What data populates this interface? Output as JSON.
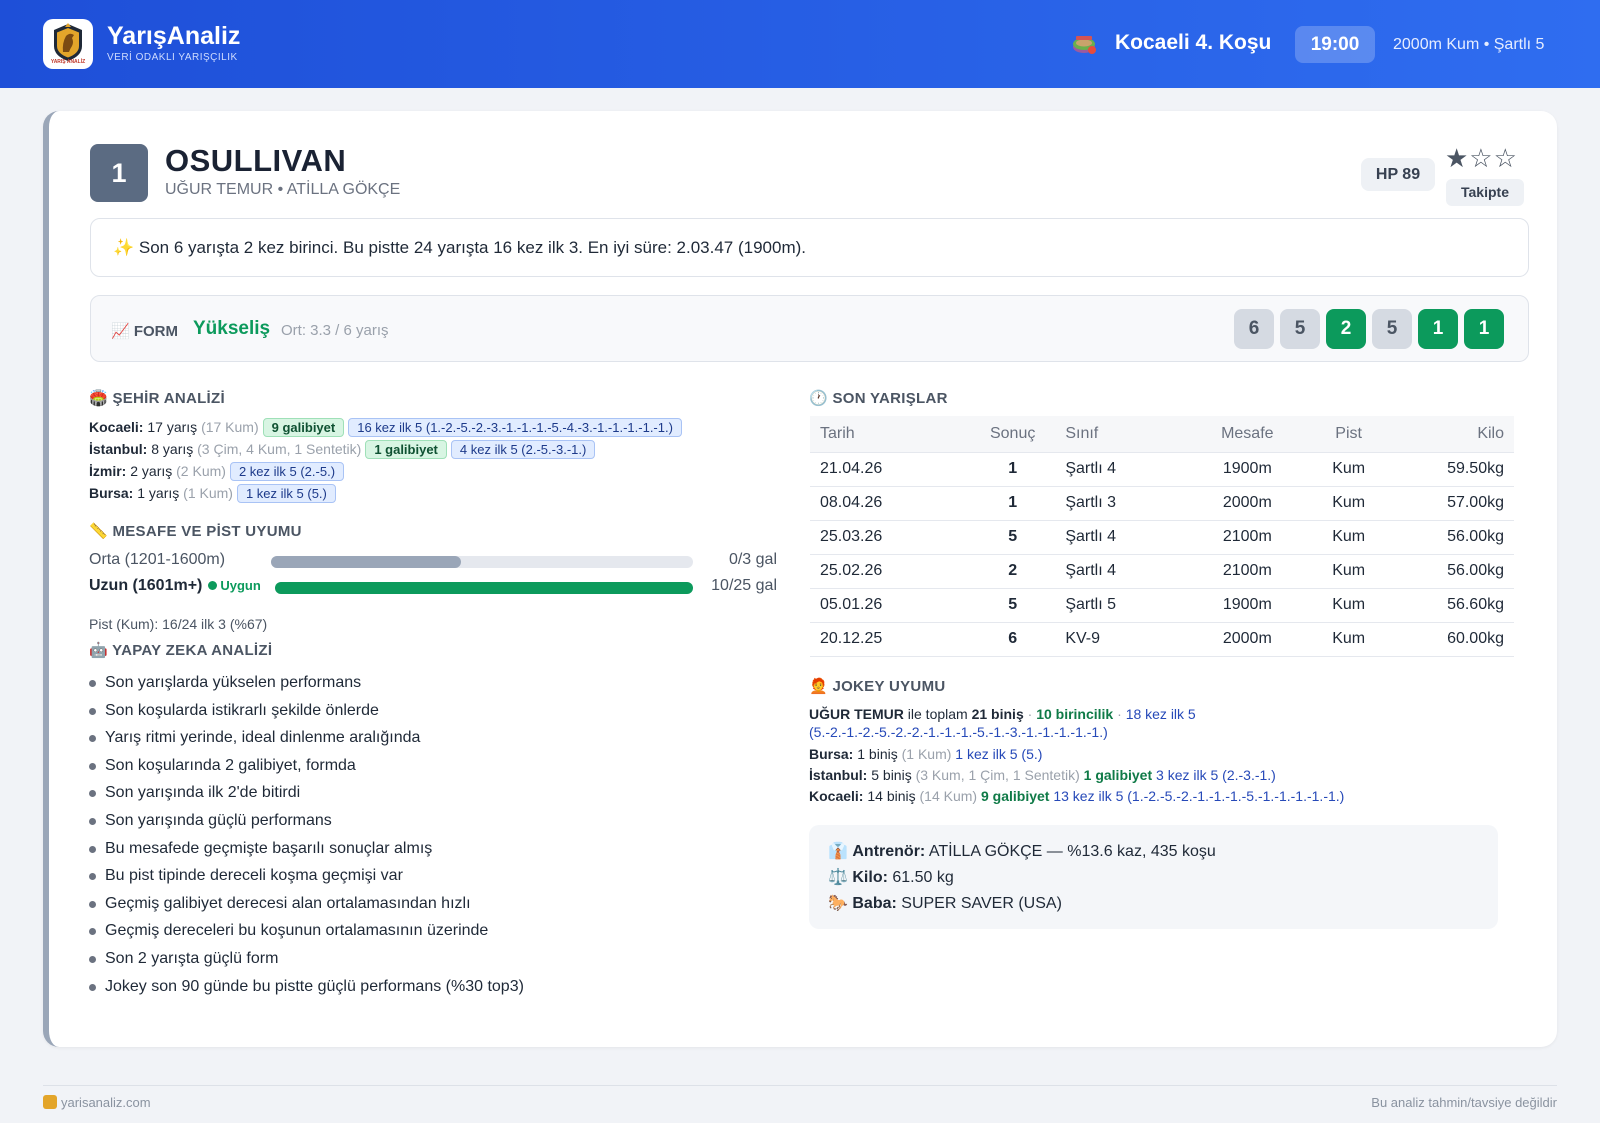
{
  "header": {
    "brand_name": "YarışAnaliz",
    "brand_tagline": "VERİ ODAKLI YARIŞÇILIK",
    "logo_text": "YARIŞ ANALİZ",
    "race_title": "Kocaeli 4. Koşu",
    "race_time": "19:00",
    "race_meta": "2000m Kum • Şartlı 5",
    "brand_color": "#2a62e8"
  },
  "horse": {
    "number": "1",
    "name": "OSULLIVAN",
    "subtitle": "UĞUR TEMUR • ATİLLA GÖKÇE",
    "hp": "HP 89",
    "stars": "★☆☆",
    "rating": 1,
    "rating_max": 3,
    "follow_label": "Takipte"
  },
  "summary": "✨ Son 6 yarışta 2 kez birinci. Bu pistte 24 yarışta 16 kez ilk 3. En iyi süre: 2.03.47 (1900m).",
  "form": {
    "label": "📈 FORM",
    "trend": "Yükseliş",
    "average": "Ort: 3.3 / 6 yarış",
    "results": [
      "6",
      "5",
      "2",
      "5",
      "1",
      "1"
    ]
  },
  "city": {
    "title": "🏟️ ŞEHİR ANALİZİ",
    "rows": [
      {
        "city": "Kocaeli:",
        "count": "17 yarış",
        "detail": "(17 Kum)",
        "win": "9 galibiyet",
        "top5": "16 kez ilk 5 (1.-2.-5.-2.-3.-1.-1.-1.-5.-4.-3.-1.-1.-1.-1.-1.)"
      },
      {
        "city": "İstanbul:",
        "count": "8 yarış",
        "detail": "(3 Çim, 4 Kum, 1 Sentetik)",
        "win": "1 galibiyet",
        "top5": "4 kez ilk 5 (2.-5.-3.-1.)"
      },
      {
        "city": "İzmir:",
        "count": "2 yarış",
        "detail": "(2 Kum)",
        "win": "",
        "top5": "2 kez ilk 5 (2.-5.)"
      },
      {
        "city": "Bursa:",
        "count": "1 yarış",
        "detail": "(1 Kum)",
        "win": "",
        "top5": "1 kez ilk 5 (5.)"
      }
    ]
  },
  "distance": {
    "title": "📏 MESAFE VE PİST UYUMU",
    "rows": [
      {
        "label": "Orta (1201-1600m)",
        "value": "0/3 gal",
        "fill": 0.45,
        "bold": false,
        "badge": ""
      },
      {
        "label": "Uzun (1601m+)",
        "value": "10/25 gal",
        "fill": 1.0,
        "bold": true,
        "badge": "Uygun"
      }
    ],
    "pist": "Pist (Kum): 16/24 ilk 3 (%67)"
  },
  "ai": {
    "title": "🤖 YAPAY ZEKA ANALİZİ",
    "items": [
      "Son yarışlarda yükselen performans",
      "Son koşularda istikrarlı şekilde önlerde",
      "Yarış ritmi yerinde, ideal dinlenme aralığında",
      "Son koşularında 2 galibiyet, formda",
      "Son yarışında ilk 2'de bitirdi",
      "Son yarışında güçlü performans",
      "Bu mesafede geçmişte başarılı sonuçlar almış",
      "Bu pist tipinde dereceli koşma geçmişi var",
      "Geçmiş galibiyet derecesi alan ortalamasından hızlı",
      "Geçmiş dereceleri bu koşunun ortalamasının üzerinde",
      "Son 2 yarışta güçlü form",
      "Jokey son 90 günde bu pistte güçlü performans (%30 top3)"
    ]
  },
  "races": {
    "title": "🕐 SON YARIŞLAR",
    "columns": [
      "Tarih",
      "Sonuç",
      "Sınıf",
      "Mesafe",
      "Pist",
      "Kilo"
    ],
    "rows": [
      {
        "date": "21.04.26",
        "result": "1",
        "class": "Şartlı 4",
        "distance": "1900m",
        "track": "Kum",
        "weight": "59.50kg"
      },
      {
        "date": "08.04.26",
        "result": "1",
        "class": "Şartlı 3",
        "distance": "2000m",
        "track": "Kum",
        "weight": "57.00kg"
      },
      {
        "date": "25.03.26",
        "result": "5",
        "class": "Şartlı 4",
        "distance": "2100m",
        "track": "Kum",
        "weight": "56.00kg"
      },
      {
        "date": "25.02.26",
        "result": "2",
        "class": "Şartlı 4",
        "distance": "2100m",
        "track": "Kum",
        "weight": "56.00kg"
      },
      {
        "date": "05.01.26",
        "result": "5",
        "class": "Şartlı 5",
        "distance": "1900m",
        "track": "Kum",
        "weight": "56.60kg"
      },
      {
        "date": "20.12.25",
        "result": "6",
        "class": "KV-9",
        "distance": "2000m",
        "track": "Kum",
        "weight": "60.00kg"
      }
    ]
  },
  "jockey": {
    "title": "🧑‍🦰 JOKEY UYUMU",
    "name": "UĞUR TEMUR",
    "intro": " ile toplam ",
    "rides": "21 biniş",
    "sep1": " · ",
    "wins": "10 birincilik",
    "sep2": " · ",
    "top5": "18 kez ilk 5",
    "top5_detail": "(5.-2.-1.-2.-5.-2.-2.-1.-1.-1.-5.-1.-3.-1.-1.-1.-1.-1.)",
    "cities": [
      {
        "city": "Bursa:",
        "rides": "1 biniş",
        "detail": "(1 Kum)",
        "win": "",
        "top5": "1 kez ilk 5 (5.)"
      },
      {
        "city": "İstanbul:",
        "rides": "5 biniş",
        "detail": "(3 Kum, 1 Çim, 1 Sentetik)",
        "win": "1 galibiyet",
        "top5": "3 kez ilk 5 (2.-3.-1.)"
      },
      {
        "city": "Kocaeli:",
        "rides": "14 biniş",
        "detail": "(14 Kum)",
        "win": "9 galibiyet",
        "top5": "13 kez ilk 5 (1.-2.-5.-2.-1.-1.-1.-5.-1.-1.-1.-1.-1.)"
      }
    ]
  },
  "info": {
    "trainer_icon": "👔",
    "trainer_label": "Antrenör:",
    "trainer_value": "ATİLLA GÖKÇE — %13.6 kaz, 435 koşu",
    "weight_icon": "⚖️",
    "weight_label": "Kilo:",
    "weight_value": "61.50 kg",
    "sire_icon": "🐎",
    "sire_label": "Baba:",
    "sire_value": "SUPER SAVER (USA)"
  },
  "footer": {
    "site": "yarisanaliz.com",
    "disclaimer": "Bu analiz tahmin/tavsiye değildir"
  }
}
